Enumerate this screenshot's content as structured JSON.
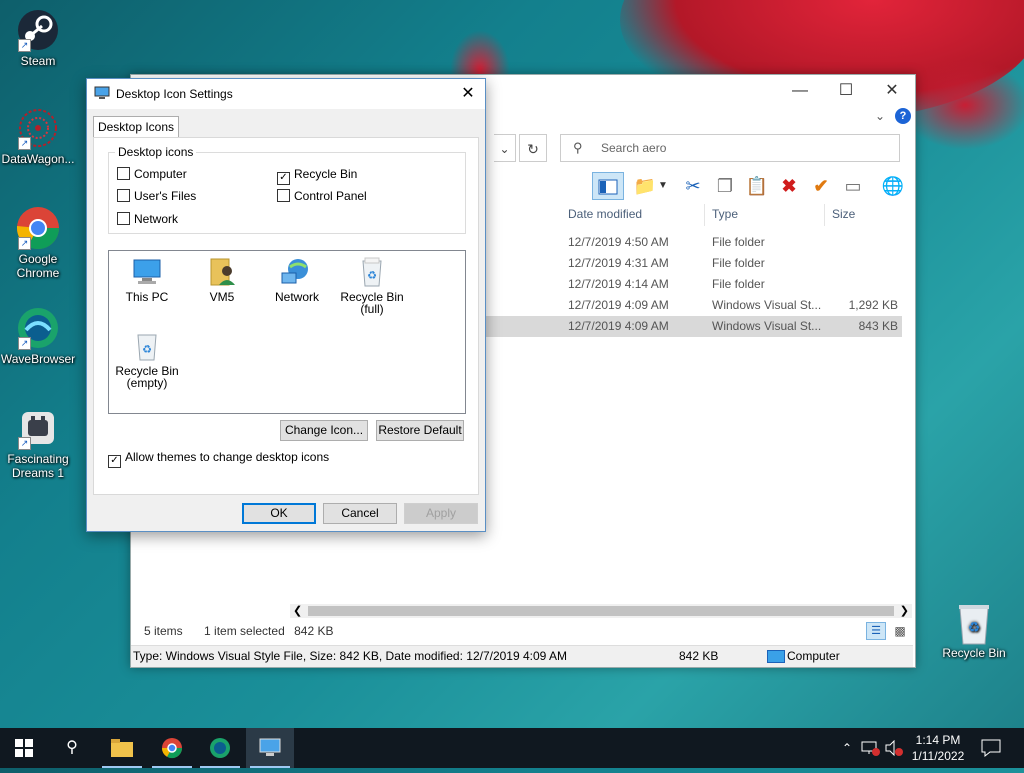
{
  "desktop": {
    "icons": [
      {
        "label": "Steam"
      },
      {
        "label": "DataWagon..."
      },
      {
        "label": "Google Chrome"
      },
      {
        "label": "WaveBrowser"
      },
      {
        "label": "Fascinating Dreams 1"
      },
      {
        "label": "Recycle Bin"
      }
    ]
  },
  "explorer": {
    "search_placeholder": "Search aero",
    "columns": {
      "date": "Date modified",
      "type": "Type",
      "size": "Size"
    },
    "rows": [
      {
        "date": "12/7/2019 4:50 AM",
        "type": "File folder",
        "size": ""
      },
      {
        "date": "12/7/2019 4:31 AM",
        "type": "File folder",
        "size": ""
      },
      {
        "date": "12/7/2019 4:14 AM",
        "type": "File folder",
        "size": ""
      },
      {
        "date": "12/7/2019 4:09 AM",
        "type": "Windows Visual St...",
        "size": "1,292 KB"
      },
      {
        "date": "12/7/2019 4:09 AM",
        "type": "Windows Visual St...",
        "size": "843 KB"
      }
    ],
    "status": {
      "items": "5 items",
      "selected": "1 item selected",
      "selected_size": "842 KB"
    },
    "statusbar": {
      "info": "Type: Windows Visual Style File, Size: 842 KB, Date modified: 12/7/2019 4:09 AM",
      "size": "842 KB",
      "location": "Computer"
    }
  },
  "dialog": {
    "title": "Desktop Icon Settings",
    "tab": "Desktop Icons",
    "group_label": "Desktop icons",
    "checkboxes": [
      {
        "label": "Computer",
        "checked": false
      },
      {
        "label": "Recycle Bin",
        "checked": true
      },
      {
        "label": "User's Files",
        "checked": false
      },
      {
        "label": "Control Panel",
        "checked": false
      },
      {
        "label": "Network",
        "checked": false
      }
    ],
    "icons": [
      {
        "label": "This PC"
      },
      {
        "label": "VM5"
      },
      {
        "label": "Network"
      },
      {
        "label": "Recycle Bin",
        "sub": "(full)"
      },
      {
        "label": "Recycle Bin",
        "sub": "(empty)"
      }
    ],
    "change_icon": "Change Icon...",
    "restore_default": "Restore Default",
    "allow_themes": "Allow themes to change desktop icons",
    "allow_themes_checked": true,
    "ok": "OK",
    "cancel": "Cancel",
    "apply": "Apply"
  },
  "taskbar": {
    "time": "1:14 PM",
    "date": "1/11/2022"
  }
}
